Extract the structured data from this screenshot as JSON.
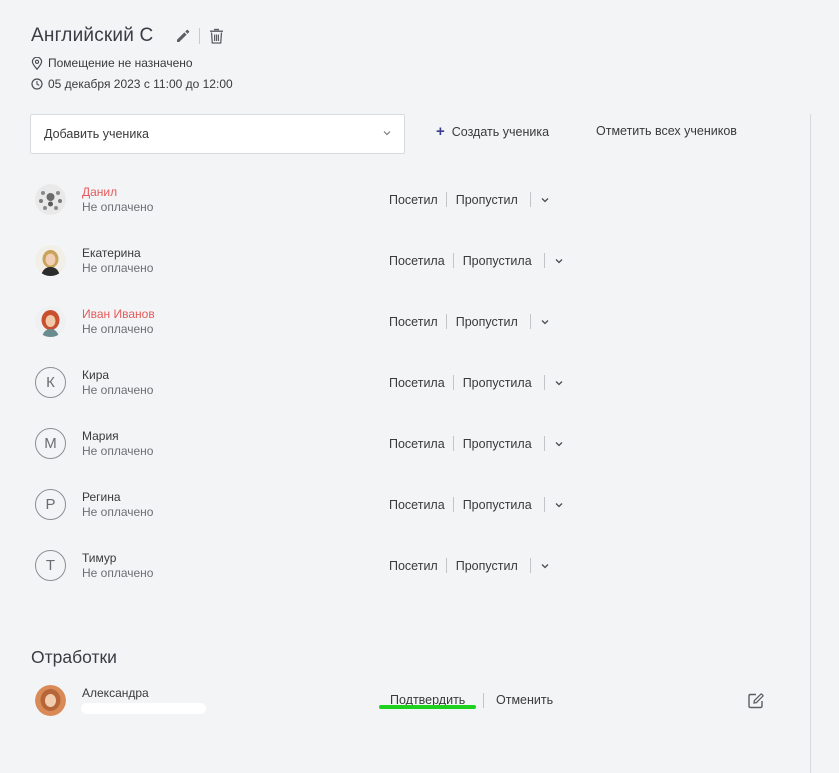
{
  "lesson": {
    "title": "Английский С",
    "room": "Помещение не назначено",
    "datetime": "05 декабря 2023 с 11:00 до 12:00"
  },
  "toolbar": {
    "add_student_placeholder": "Добавить ученика",
    "create_student_label": "Создать ученика",
    "mark_all_label": "Отметить всех учеников"
  },
  "students": [
    {
      "name": "Данил",
      "status": "Не оплачено",
      "attended": "Посетил",
      "missed": "Пропустил",
      "name_color": "red",
      "avatar": "photo"
    },
    {
      "name": "Екатерина",
      "status": "Не оплачено",
      "attended": "Посетила",
      "missed": "Пропустила",
      "name_color": "default",
      "avatar": "photo"
    },
    {
      "name": "Иван Иванов",
      "status": "Не оплачено",
      "attended": "Посетил",
      "missed": "Пропустил",
      "name_color": "red",
      "avatar": "photo"
    },
    {
      "name": "Кира",
      "status": "Не оплачено",
      "attended": "Посетила",
      "missed": "Пропустила",
      "name_color": "default",
      "avatar_letter": "К"
    },
    {
      "name": "Мария",
      "status": "Не оплачено",
      "attended": "Посетила",
      "missed": "Пропустила",
      "name_color": "default",
      "avatar_letter": "М"
    },
    {
      "name": "Регина",
      "status": "Не оплачено",
      "attended": "Посетила",
      "missed": "Пропустила",
      "name_color": "default",
      "avatar_letter": "Р"
    },
    {
      "name": "Тимур",
      "status": "Не оплачено",
      "attended": "Посетил",
      "missed": "Пропустил",
      "name_color": "default",
      "avatar_letter": "Т"
    }
  ],
  "makeups": {
    "title": "Отработки",
    "items": [
      {
        "name": "Александра",
        "confirm_label": "Подтвердить",
        "cancel_label": "Отменить"
      }
    ]
  },
  "colors": {
    "accent_red": "#e55b5b",
    "highlight_green": "#1ed11e",
    "plus_accent": "#3b3b8f",
    "background": "#f3f4f6"
  },
  "icons": {
    "edit": "pencil-icon",
    "delete": "trash-icon",
    "room": "location-pin-icon",
    "time": "clock-icon",
    "dropdown": "chevron-down-icon",
    "create": "plus-icon",
    "note": "note-edit-icon"
  }
}
